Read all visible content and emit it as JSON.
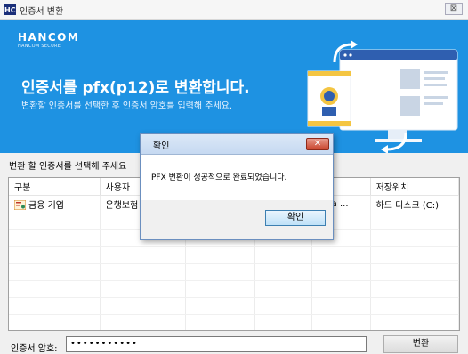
{
  "window": {
    "title": "인증서 변환",
    "close_label": "⊠",
    "icon": "hancom-app-icon"
  },
  "banner": {
    "brand_name": "HANCOM",
    "brand_sub": "HANCOM SECURE",
    "headline": "인증서를 pfx(p12)로 변환합니다.",
    "subline": "변환할 인증서를 선택한 후 인증서 암호를 입력해 주세요.",
    "background_color": "#1e92e2"
  },
  "cert_list": {
    "label": "변환 할 인증서를 선택해 주세요",
    "columns": [
      "구분",
      "사용자",
      "",
      "",
      "자",
      "저장위치"
    ],
    "rows": [
      {
        "type": "금융 기업",
        "user": "은행보험",
        "c3": "",
        "c4": "",
        "issuer": "orea ...",
        "location": "하드 디스크 (C:)"
      }
    ]
  },
  "password": {
    "label": "인증서 암호:",
    "value": "•••••••••••"
  },
  "convert_button": "변환",
  "dialog": {
    "title": "확인",
    "close_label": "✕",
    "message": "PFX 변환이 성공적으로 완료되었습니다.",
    "ok_label": "확인"
  }
}
